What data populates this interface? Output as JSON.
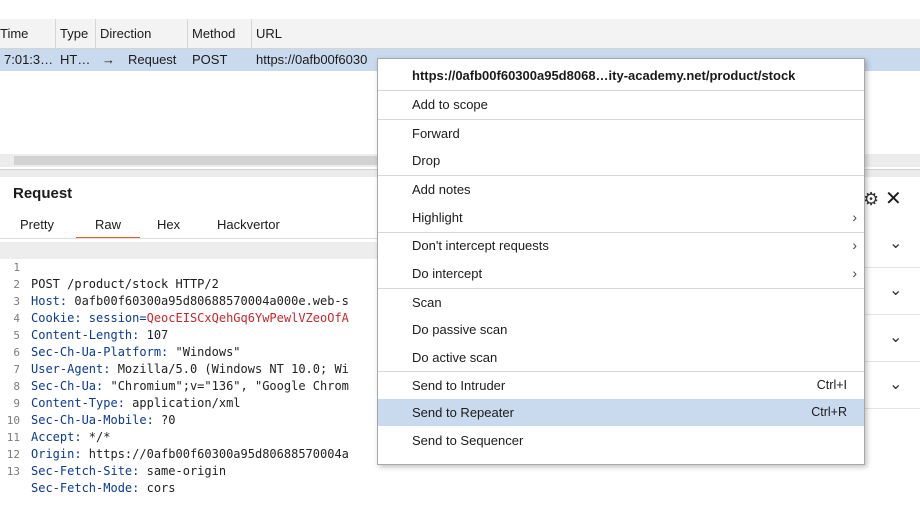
{
  "table": {
    "columns": [
      "Time",
      "Type",
      "Direction",
      "Method",
      "URL"
    ],
    "row": {
      "time": "7:01:3…",
      "type": "HT…",
      "direction_arrow": "→",
      "direction": "Request",
      "method": "POST",
      "url": "https://0afb00f6030"
    }
  },
  "request_panel": {
    "title": "Request",
    "tabs": [
      "Pretty",
      "Raw",
      "Hex",
      "Hackvertor"
    ],
    "active_tab": "Raw",
    "lines": [
      {
        "n": "1",
        "text": "POST /product/stock HTTP/2"
      },
      {
        "n": "2",
        "h": "Host:",
        "v": " 0afb00f60300a95d80688570004a000e.web-s"
      },
      {
        "n": "3",
        "h": "Cookie:",
        "v": " session=",
        "v2": "QeocEISCxQehGq6YwPewlVZeoOfA"
      },
      {
        "n": "4",
        "h": "Content-Length:",
        "v": " 107"
      },
      {
        "n": "5",
        "h": "Sec-Ch-Ua-Platform:",
        "v": " \"Windows\""
      },
      {
        "n": "6",
        "h": "User-Agent:",
        "v": " Mozilla/5.0 (Windows NT 10.0; Wi"
      },
      {
        "n": "7",
        "h": "Sec-Ch-Ua:",
        "v": " \"Chromium\";v=\"136\", \"Google Chrom"
      },
      {
        "n": "8",
        "h": "Content-Type:",
        "v": " application/xml"
      },
      {
        "n": "9",
        "h": "Sec-Ch-Ua-Mobile:",
        "v": " ?0"
      },
      {
        "n": "10",
        "h": "Accept:",
        "v": " */*"
      },
      {
        "n": "11",
        "h": "Origin:",
        "v": " https://0afb00f60300a95d80688570004a"
      },
      {
        "n": "12",
        "h": "Sec-Fetch-Site:",
        "v": " same-origin"
      },
      {
        "n": "13",
        "h": "Sec-Fetch-Mode:",
        "v": " cors"
      }
    ]
  },
  "context_menu": {
    "header": "https://0afb00f60300a95d8068…ity-academy.net/product/stock",
    "items": [
      {
        "label": "Add to scope"
      },
      {
        "label": "Forward"
      },
      {
        "label": "Drop"
      },
      {
        "label": "Add notes"
      },
      {
        "label": "Highlight",
        "submenu": "›"
      },
      {
        "label": "Don't intercept requests",
        "submenu": "›"
      },
      {
        "label": "Do intercept",
        "submenu": "›"
      },
      {
        "label": "Scan"
      },
      {
        "label": "Do passive scan"
      },
      {
        "label": "Do active scan"
      },
      {
        "label": "Send to Intruder",
        "shortcut": "Ctrl+I"
      },
      {
        "label": "Send to Repeater",
        "shortcut": "Ctrl+R"
      },
      {
        "label": "Send to Sequencer"
      }
    ]
  },
  "icons": {
    "close": "close-icon",
    "gear": "gear-icon",
    "chevron": "chevron-down-icon"
  },
  "colors": {
    "selection": "#c9d9ee",
    "active_tab_underline": "#e8612c",
    "header_name": "#0a3a96",
    "cookie_value": "#c8272b"
  },
  "glyphs": {
    "close": "✕",
    "gear": "⚙",
    "chevron": "⌄"
  }
}
